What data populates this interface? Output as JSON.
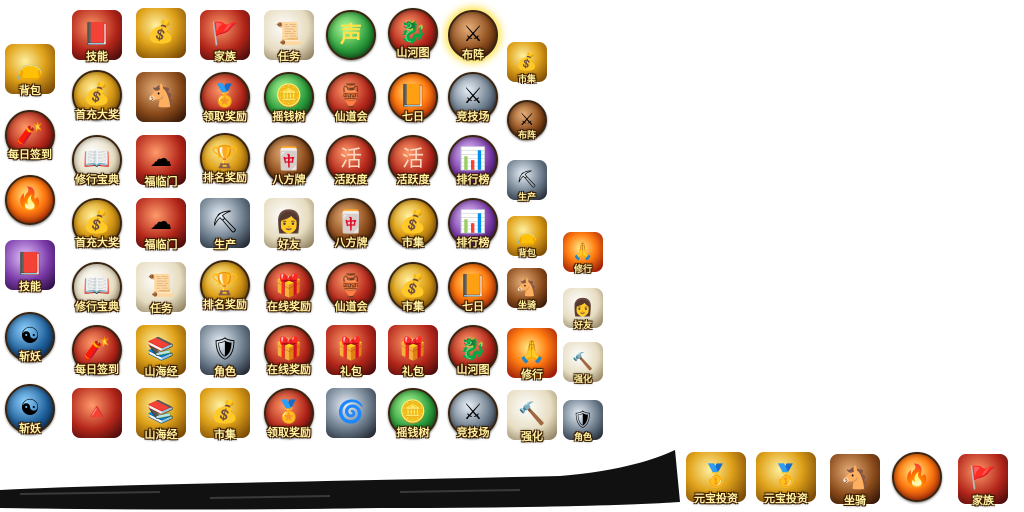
{
  "icons": [
    {
      "label": "技能",
      "icon": "book-icon",
      "glyph": "📕"
    },
    {
      "label": "",
      "icon": "gold-ingots-icon",
      "glyph": "💰"
    },
    {
      "label": "家族",
      "icon": "banner-icon",
      "glyph": "🚩"
    },
    {
      "label": "任务",
      "icon": "scroll-icon",
      "glyph": "📜"
    },
    {
      "label": "",
      "icon": "voice-orb-icon",
      "glyph": "声"
    },
    {
      "label": "山河图",
      "icon": "dragon-medallion-icon",
      "glyph": "🐉"
    },
    {
      "label": "布阵",
      "icon": "formation-icon",
      "glyph": "⚔"
    },
    {
      "label": "市集",
      "icon": "market-bag-icon",
      "glyph": "💰"
    },
    {
      "label": "背包",
      "icon": "bag-icon",
      "glyph": "👝"
    },
    {
      "label": "首充大奖",
      "icon": "gold-pot-icon",
      "glyph": "💰"
    },
    {
      "label": "",
      "icon": "horse-head-icon",
      "glyph": "🐴"
    },
    {
      "label": "领取奖励",
      "icon": "reward-medal-icon",
      "glyph": "🏅"
    },
    {
      "label": "摇钱树",
      "icon": "coin-tree-icon",
      "glyph": "🪙"
    },
    {
      "label": "仙道会",
      "icon": "incense-burner-icon",
      "glyph": "🏺"
    },
    {
      "label": "七日",
      "icon": "seven-day-book-icon",
      "glyph": "📙"
    },
    {
      "label": "竞技场",
      "icon": "crossed-swords-icon",
      "glyph": "⚔"
    },
    {
      "label": "布阵",
      "icon": "formation-small-icon",
      "glyph": "⚔"
    },
    {
      "label": "每日签到",
      "icon": "firecracker-icon",
      "glyph": "🧨"
    },
    {
      "label": "修行宝典",
      "icon": "manual-icon",
      "glyph": "📖"
    },
    {
      "label": "福临门",
      "icon": "lucky-cloud-icon",
      "glyph": "☁"
    },
    {
      "label": "排名奖励",
      "icon": "ranking-vessel-icon",
      "glyph": "🏆"
    },
    {
      "label": "八方牌",
      "icon": "tablet-icon",
      "glyph": "🀄"
    },
    {
      "label": "活跃度",
      "icon": "activity-jar-icon",
      "glyph": "活"
    },
    {
      "label": "活跃度",
      "icon": "activity-jar-icon",
      "glyph": "活"
    },
    {
      "label": "排行榜",
      "icon": "leaderboard-icon",
      "glyph": "📊"
    },
    {
      "label": "生产",
      "icon": "pickaxe-small-icon",
      "glyph": "⛏"
    },
    {
      "label": "",
      "icon": "fire-orb-icon",
      "glyph": "🔥"
    },
    {
      "label": "首充大奖",
      "icon": "gold-pot-icon",
      "glyph": "💰"
    },
    {
      "label": "福临门",
      "icon": "lucky-cloud-icon",
      "glyph": "☁"
    },
    {
      "label": "生产",
      "icon": "pickaxe-icon",
      "glyph": "⛏"
    },
    {
      "label": "好友",
      "icon": "friend-portrait-icon",
      "glyph": "👩"
    },
    {
      "label": "八方牌",
      "icon": "tablet-icon",
      "glyph": "🀄"
    },
    {
      "label": "市集",
      "icon": "market-icon",
      "glyph": "💰"
    },
    {
      "label": "排行榜",
      "icon": "leaderboard-icon",
      "glyph": "📊"
    },
    {
      "label": "背包",
      "icon": "bag-small-icon",
      "glyph": "👝"
    },
    {
      "label": "修行",
      "icon": "praying-hands-small-icon",
      "glyph": "🙏"
    },
    {
      "label": "技能",
      "icon": "book-glow-icon",
      "glyph": "📕"
    },
    {
      "label": "修行宝典",
      "icon": "manual-icon",
      "glyph": "📖"
    },
    {
      "label": "任务",
      "icon": "scroll-icon",
      "glyph": "📜"
    },
    {
      "label": "排名奖励",
      "icon": "ranking-vessel-icon",
      "glyph": "🏆"
    },
    {
      "label": "在线奖励",
      "icon": "gift-box-icon",
      "glyph": "🎁"
    },
    {
      "label": "仙道会",
      "icon": "incense-burner-icon",
      "glyph": "🏺"
    },
    {
      "label": "市集",
      "icon": "market-icon",
      "glyph": "💰"
    },
    {
      "label": "七日",
      "icon": "seven-day-book-icon",
      "glyph": "📙"
    },
    {
      "label": "坐骑",
      "icon": "mount-small-icon",
      "glyph": "🐴"
    },
    {
      "label": "好友",
      "icon": "friend-small-icon",
      "glyph": "👩"
    },
    {
      "label": "斩妖",
      "icon": "taiji-sword-icon",
      "glyph": "☯"
    },
    {
      "label": "每日签到",
      "icon": "firecracker-icon",
      "glyph": "🧨"
    },
    {
      "label": "山海经",
      "icon": "classic-book-icon",
      "glyph": "📚"
    },
    {
      "label": "角色",
      "icon": "armor-icon",
      "glyph": "🛡"
    },
    {
      "label": "在线奖励",
      "icon": "gift-box-icon",
      "glyph": "🎁"
    },
    {
      "label": "礼包",
      "icon": "gift-pack-icon",
      "glyph": "🎁"
    },
    {
      "label": "礼包",
      "icon": "gift-pack-icon",
      "glyph": "🎁"
    },
    {
      "label": "山河图",
      "icon": "dragon-medallion-icon",
      "glyph": "🐉"
    },
    {
      "label": "修行",
      "icon": "praying-hands-icon",
      "glyph": "🙏"
    },
    {
      "label": "强化",
      "icon": "forge-small-icon",
      "glyph": "🔨"
    },
    {
      "label": "斩妖",
      "icon": "taiji-sword-icon",
      "glyph": "☯"
    },
    {
      "label": "",
      "icon": "winged-emblem-icon",
      "glyph": "🔺"
    },
    {
      "label": "山海经",
      "icon": "classic-book-icon",
      "glyph": "📚"
    },
    {
      "label": "市集",
      "icon": "market-icon",
      "glyph": "💰"
    },
    {
      "label": "领取奖励",
      "icon": "reward-medal-icon",
      "glyph": "🏅"
    },
    {
      "label": "",
      "icon": "swirl-stone-icon",
      "glyph": "🌀"
    },
    {
      "label": "摇钱树",
      "icon": "coin-tree-icon",
      "glyph": "🪙"
    },
    {
      "label": "竞技场",
      "icon": "crossed-swords-icon",
      "glyph": "⚔"
    },
    {
      "label": "强化",
      "icon": "forge-icon",
      "glyph": "🔨"
    },
    {
      "label": "角色",
      "icon": "armor-small-icon",
      "glyph": "🛡"
    },
    {
      "label": "元宝投资",
      "icon": "ingot-invest-icon",
      "glyph": "🥇"
    },
    {
      "label": "元宝投资",
      "icon": "ingot-invest-icon",
      "glyph": "🥇"
    },
    {
      "label": "坐骑",
      "icon": "mount-icon",
      "glyph": "🐴"
    },
    {
      "label": "",
      "icon": "fire-orb-icon",
      "glyph": "🔥"
    },
    {
      "label": "家族",
      "icon": "banner-icon",
      "glyph": "🚩"
    }
  ]
}
